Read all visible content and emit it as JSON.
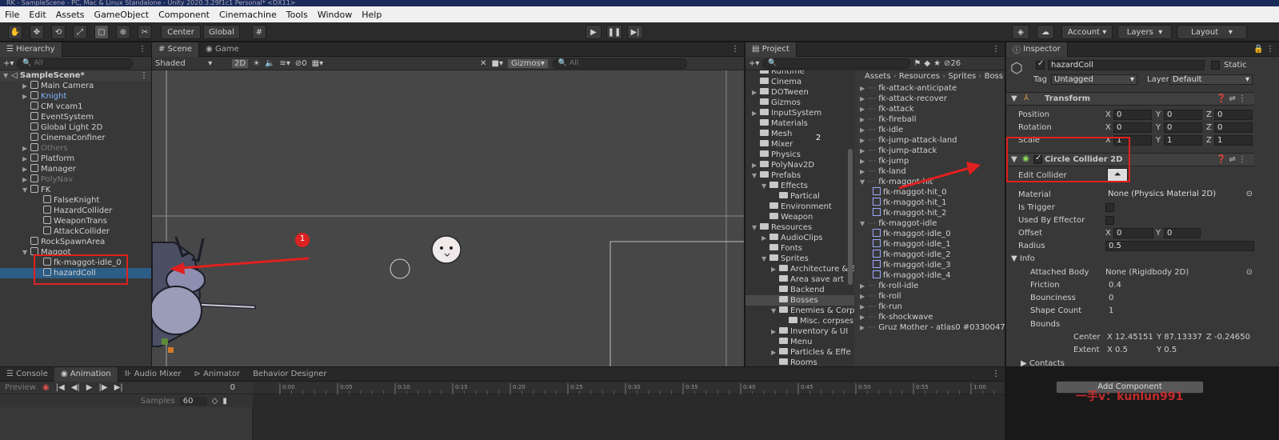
{
  "window": {
    "title": "RK - SampleScene - PC, Mac & Linux Standalone - Unity 2020.3.29f1c1 Personal* <DX11>"
  },
  "menu": [
    "File",
    "Edit",
    "Assets",
    "GameObject",
    "Component",
    "Cinemachine",
    "Tools",
    "Window",
    "Help"
  ],
  "toolbar": {
    "center": "Center",
    "global": "Global",
    "account": "Account",
    "layers": "Layers",
    "layout": "Layout"
  },
  "hierarchy": {
    "tab": "Hierarchy",
    "search_placeholder": "All",
    "scene": "SampleScene*",
    "items": [
      {
        "label": "Main Camera",
        "depth": 1,
        "state": "normal"
      },
      {
        "label": "Knight",
        "depth": 1,
        "state": "prefab"
      },
      {
        "label": "CM vcam1",
        "depth": 1,
        "state": "normal"
      },
      {
        "label": "EventSystem",
        "depth": 1,
        "state": "normal"
      },
      {
        "label": "Global Light 2D",
        "depth": 1,
        "state": "normal"
      },
      {
        "label": "CinemaConfiner",
        "depth": 1,
        "state": "normal"
      },
      {
        "label": "Others",
        "depth": 1,
        "state": "dim"
      },
      {
        "label": "Platform",
        "depth": 1,
        "state": "normal"
      },
      {
        "label": "Manager",
        "depth": 1,
        "state": "normal"
      },
      {
        "label": "PolyNav",
        "depth": 1,
        "state": "dim"
      },
      {
        "label": "FK",
        "depth": 1,
        "state": "normal"
      },
      {
        "label": "FalseKnight",
        "depth": 2,
        "state": "normal"
      },
      {
        "label": "HazardCollider",
        "depth": 2,
        "state": "normal"
      },
      {
        "label": "WeaponTrans",
        "depth": 2,
        "state": "normal"
      },
      {
        "label": "AttackCollider",
        "depth": 2,
        "state": "normal"
      },
      {
        "label": "RockSpawnArea",
        "depth": 1,
        "state": "normal"
      },
      {
        "label": "Maggot",
        "depth": 1,
        "state": "normal"
      },
      {
        "label": "fk-maggot-idle_0",
        "depth": 2,
        "state": "normal"
      },
      {
        "label": "hazardColl",
        "depth": 2,
        "state": "selected"
      }
    ]
  },
  "scene": {
    "tab_scene": "Scene",
    "tab_game": "Game",
    "shading": "Shaded",
    "mode_2d": "2D",
    "hidden_count": "0",
    "gizmos": "Gizmos",
    "search_placeholder": "All"
  },
  "annotations": [
    {
      "label": "1"
    },
    {
      "label": "2"
    }
  ],
  "project": {
    "tab": "Project",
    "count": "26",
    "breadcrumb": [
      "Assets",
      "Resources",
      "Sprites",
      "Boss"
    ],
    "folders": [
      {
        "label": "Runtime",
        "depth": 0,
        "arrow": ""
      },
      {
        "label": "Cinema",
        "depth": 0,
        "arrow": ""
      },
      {
        "label": "DOTween",
        "depth": 0,
        "arrow": "▶"
      },
      {
        "label": "Gizmos",
        "depth": 0,
        "arrow": ""
      },
      {
        "label": "InputSystem",
        "depth": 0,
        "arrow": "▶"
      },
      {
        "label": "Materials",
        "depth": 0,
        "arrow": ""
      },
      {
        "label": "Mesh",
        "depth": 0,
        "arrow": ""
      },
      {
        "label": "Mixer",
        "depth": 0,
        "arrow": ""
      },
      {
        "label": "Physics",
        "depth": 0,
        "arrow": ""
      },
      {
        "label": "PolyNav2D",
        "depth": 0,
        "arrow": "▶"
      },
      {
        "label": "Prefabs",
        "depth": 0,
        "arrow": "▼"
      },
      {
        "label": "Effects",
        "depth": 1,
        "arrow": "▼"
      },
      {
        "label": "Partical",
        "depth": 2,
        "arrow": ""
      },
      {
        "label": "Environment",
        "depth": 1,
        "arrow": ""
      },
      {
        "label": "Weapon",
        "depth": 1,
        "arrow": ""
      },
      {
        "label": "Resources",
        "depth": 0,
        "arrow": "▼"
      },
      {
        "label": "AudioClips",
        "depth": 1,
        "arrow": "▶"
      },
      {
        "label": "Fonts",
        "depth": 1,
        "arrow": ""
      },
      {
        "label": "Sprites",
        "depth": 1,
        "arrow": "▼"
      },
      {
        "label": "Architecture & E",
        "depth": 2,
        "arrow": "▶"
      },
      {
        "label": "Area save art",
        "depth": 2,
        "arrow": ""
      },
      {
        "label": "Backend",
        "depth": 2,
        "arrow": ""
      },
      {
        "label": "Bosses",
        "depth": 2,
        "arrow": "",
        "selected": true
      },
      {
        "label": "Enemies & Corp",
        "depth": 2,
        "arrow": "▼"
      },
      {
        "label": "Misc. corpses",
        "depth": 3,
        "arrow": ""
      },
      {
        "label": "Inventory & UI",
        "depth": 2,
        "arrow": "▶"
      },
      {
        "label": "Menu",
        "depth": 2,
        "arrow": ""
      },
      {
        "label": "Particles & Effe",
        "depth": 2,
        "arrow": "▶"
      },
      {
        "label": "Rooms",
        "depth": 2,
        "arrow": ""
      }
    ],
    "assets": [
      {
        "label": "fk-attack-anticipate",
        "sub": false,
        "arrow": "▶"
      },
      {
        "label": "fk-attack-recover",
        "sub": false,
        "arrow": "▶"
      },
      {
        "label": "fk-attack",
        "sub": false,
        "arrow": "▶"
      },
      {
        "label": "fk-fireball",
        "sub": false,
        "arrow": "▶"
      },
      {
        "label": "fk-idle",
        "sub": false,
        "arrow": "▶"
      },
      {
        "label": "fk-jump-attack-land",
        "sub": false,
        "arrow": "▶"
      },
      {
        "label": "fk-jump-attack",
        "sub": false,
        "arrow": "▶"
      },
      {
        "label": "fk-jump",
        "sub": false,
        "arrow": "▶"
      },
      {
        "label": "fk-land",
        "sub": false,
        "arrow": "▶"
      },
      {
        "label": "fk-maggot-hit",
        "sub": false,
        "arrow": "▼"
      },
      {
        "label": "fk-maggot-hit_0",
        "sub": true,
        "arrow": ""
      },
      {
        "label": "fk-maggot-hit_1",
        "sub": true,
        "arrow": ""
      },
      {
        "label": "fk-maggot-hit_2",
        "sub": true,
        "arrow": ""
      },
      {
        "label": "fk-maggot-idle",
        "sub": false,
        "arrow": "▼"
      },
      {
        "label": "fk-maggot-idle_0",
        "sub": true,
        "arrow": ""
      },
      {
        "label": "fk-maggot-idle_1",
        "sub": true,
        "arrow": ""
      },
      {
        "label": "fk-maggot-idle_2",
        "sub": true,
        "arrow": ""
      },
      {
        "label": "fk-maggot-idle_3",
        "sub": true,
        "arrow": ""
      },
      {
        "label": "fk-maggot-idle_4",
        "sub": true,
        "arrow": ""
      },
      {
        "label": "fk-roll-idle",
        "sub": false,
        "arrow": "▶"
      },
      {
        "label": "fk-roll",
        "sub": false,
        "arrow": "▶"
      },
      {
        "label": "fk-run",
        "sub": false,
        "arrow": "▶"
      },
      {
        "label": "fk-shockwave",
        "sub": false,
        "arrow": "▶"
      },
      {
        "label": "Gruz Mother - atlas0 #0330047",
        "sub": false,
        "arrow": "▶"
      }
    ]
  },
  "inspector": {
    "tab": "Inspector",
    "object_name": "hazardColl",
    "static": "Static",
    "tag_label": "Tag",
    "tag_value": "Untagged",
    "layer_label": "Layer",
    "layer_value": "Default",
    "transform": {
      "title": "Transform",
      "position": "Position",
      "rotation": "Rotation",
      "scale": "Scale",
      "pos": [
        "0",
        "0",
        "0"
      ],
      "rot": [
        "0",
        "0",
        "0"
      ],
      "scl": [
        "1",
        "1",
        "1"
      ]
    },
    "collider": {
      "title": "Circle Collider 2D",
      "edit_collider": "Edit Collider",
      "material": "Material",
      "material_value": "None (Physics Material 2D)",
      "is_trigger": "Is Trigger",
      "used_by_effector": "Used By Effector",
      "offset": "Offset",
      "offset_x": "0",
      "offset_y": "0",
      "radius": "Radius",
      "radius_value": "0.5"
    },
    "info": {
      "title": "Info",
      "attached_body": "Attached Body",
      "attached_body_value": "None (Rigidbody 2D)",
      "friction": "Friction",
      "friction_value": "0.4",
      "bounciness": "Bounciness",
      "bounciness_value": "0",
      "shape_count": "Shape Count",
      "shape_count_value": "1",
      "bounds": "Bounds",
      "center": "Center",
      "center_x": "12.45151",
      "center_y": "87.13337",
      "center_z": "-0.24650",
      "extent": "Extent",
      "extent_x": "0.5",
      "extent_y": "0.5"
    },
    "contacts": "Contacts",
    "add_component": "Add Component"
  },
  "watermark": "一手v：kunlun991",
  "bottom": {
    "tabs": [
      "Console",
      "Animation",
      "Audio Mixer",
      "Animator",
      "Behavior Designer"
    ],
    "preview": "Preview",
    "samples": "Samples",
    "samples_value": "60",
    "frame": "0",
    "ticks": [
      "0:00",
      "0:05",
      "0:10",
      "0:15",
      "0:20",
      "0:25",
      "0:30",
      "0:35",
      "0:40",
      "0:45",
      "0:50",
      "0:55",
      "1:00"
    ]
  },
  "colors": {
    "accent": "#2c5d87",
    "annotation": "#e02020",
    "title_bg": "#1a2a5a"
  }
}
